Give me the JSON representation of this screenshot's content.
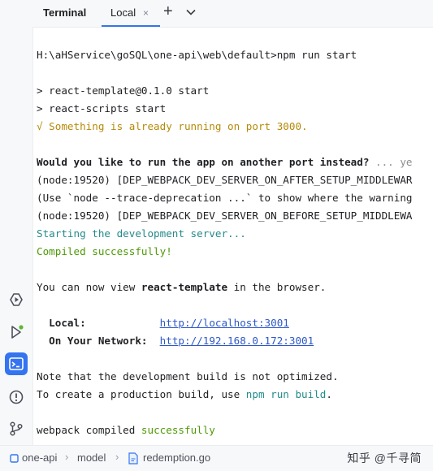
{
  "tabbar": {
    "title": "Terminal",
    "tab_label": "Local",
    "close_glyph": "×",
    "add_glyph": "+"
  },
  "sidebar": {
    "icons": [
      "services-icon",
      "run-icon",
      "terminal-icon",
      "problems-icon",
      "git-icon"
    ],
    "active_color": "#3574f0"
  },
  "terminal": {
    "prompt": "H:\\aHService\\goSQL\\one-api\\web\\default>npm run start",
    "l_template": "> react-template@0.1.0 start",
    "l_scripts": "> react-scripts start",
    "l_running": "√ Something is already running on port 3000.",
    "l_question": "Would you like to run the app on another port instead?",
    "l_question_tail": " ... ye",
    "l_dep1": "(node:19520) [DEP_WEBPACK_DEV_SERVER_ON_AFTER_SETUP_MIDDLEWAR",
    "l_use_prefix": "(Use `node --trace-deprecation ...`",
    "l_use_tail": " to show where the warning",
    "l_dep2": "(node:19520) [DEP_WEBPACK_DEV_SERVER_ON_BEFORE_SETUP_MIDDLEWA",
    "l_starting": "Starting the development server...",
    "l_compiled": "Compiled successfully!",
    "view_pre": "You can now view ",
    "view_app": "react-template",
    "view_post": " in the browser.",
    "local_label": "  Local:            ",
    "local_url": "http://localhost:3001",
    "network_label": "  On Your Network:  ",
    "network_url": "http://192.168.0.172:3001",
    "note": "Note that the development build is not optimized.",
    "create_pre": "To create a production build, use ",
    "create_cmd": "npm run build",
    "create_post": ".",
    "webpack_pre": "webpack compiled ",
    "webpack_ok": "successfully"
  },
  "statusbar": {
    "project": "one-api",
    "folder": "model",
    "file": "redemption.go",
    "watermark": "知乎 @千寻简"
  }
}
